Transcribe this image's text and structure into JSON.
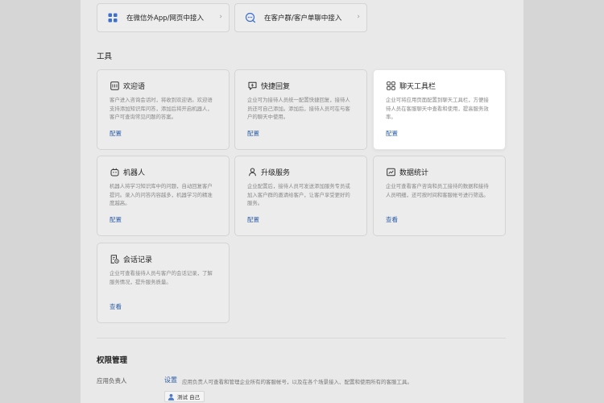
{
  "access": [
    {
      "label": "在微信外App/网页中接入",
      "icon": "grid-icon",
      "chevron": "›"
    },
    {
      "label": "在客户群/客户单聊中接入",
      "icon": "chat-bubble-icon",
      "chevron": "›"
    }
  ],
  "tools_title": "工具",
  "tools": [
    {
      "name": "欢迎语",
      "icon": "welcome-message-icon",
      "desc": "客户进入咨询会话时，将收到欢迎语。欢迎语支持添加知识库问答，添加后将开启机器人，客户可查询常见问题的答案。",
      "action": "配置"
    },
    {
      "name": "快捷回复",
      "icon": "quick-reply-icon",
      "desc": "企业可为接待人员统一配置快捷回复，接待人员还可自己添加。添加后，接待人员可在与客户的聊天中使用。",
      "action": "配置"
    },
    {
      "name": "聊天工具栏",
      "icon": "chat-toolbar-icon",
      "desc": "企业可将应用页面配置到聊天工具栏，方便接待人员在客服聊天中查看和使用，提高服务效率。",
      "action": "配置"
    },
    {
      "name": "机器人",
      "icon": "robot-icon",
      "desc": "机器人将学习知识库中的问题，自动回复客户提问。录入的问答内容越多，机器学习的精准度越高。",
      "action": "配置"
    },
    {
      "name": "升级服务",
      "icon": "upgrade-service-icon",
      "desc": "企业配置后，接待人员可发送添加服务专员或加入客户群的邀请给客户，让客户享受更好的服务。",
      "action": "配置"
    },
    {
      "name": "数据统计",
      "icon": "statistics-icon",
      "desc": "企业可查看客户咨询和员工接待的数据和接待人员明细，还可按时间和客服帐号进行筛选。",
      "action": "查看"
    },
    {
      "name": "会话记录",
      "icon": "session-record-icon",
      "desc": "企业可查看接待人员与客户的会话记录，了解服务情况，提升服务质量。",
      "action": "查看"
    }
  ],
  "permission": {
    "title": "权限管理",
    "label": "应用负责人",
    "action": "设置",
    "desc": "应用负责人可查看和管理企业所有的客服帐号，以及在各个场景接入、配置和使用所有的客服工具。",
    "user": "测试 自己"
  },
  "colors": {
    "link": "#2d5ea8",
    "accent": "#3b6fd1"
  }
}
